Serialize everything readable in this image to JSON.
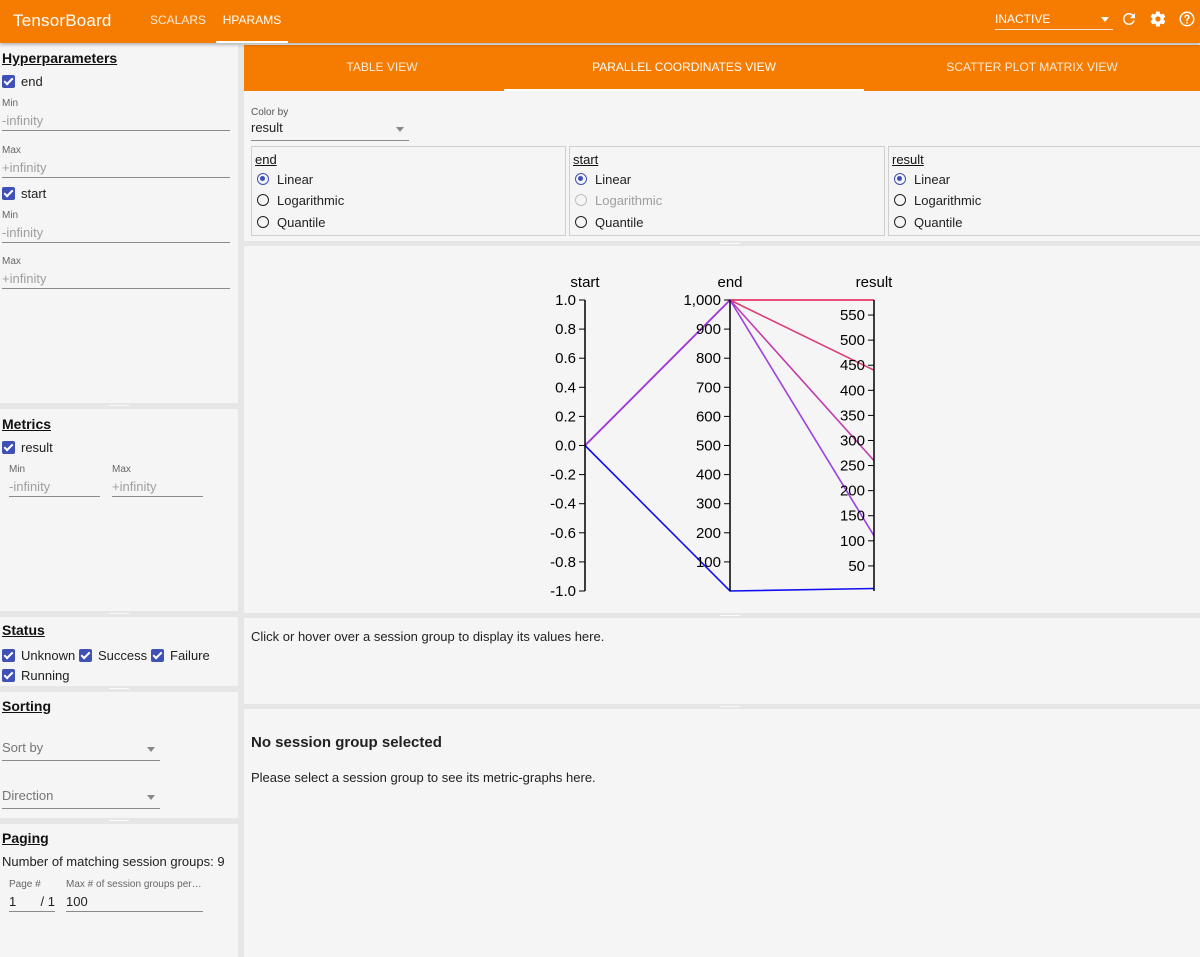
{
  "app": {
    "title": "TensorBoard",
    "tabs": [
      {
        "label": "SCALARS",
        "active": false
      },
      {
        "label": "HPARAMS",
        "active": true
      }
    ],
    "run_status": "INACTIVE",
    "icons": [
      "refresh-icon",
      "settings-icon",
      "help-icon"
    ],
    "accent_color": "#f57c00"
  },
  "sidebar": {
    "hyperparameters": {
      "title": "Hyperparameters",
      "items": [
        {
          "name": "end",
          "checked": true,
          "min_label": "Min",
          "min_placeholder": "-infinity",
          "max_label": "Max",
          "max_placeholder": "+infinity"
        },
        {
          "name": "start",
          "checked": true,
          "min_label": "Min",
          "min_placeholder": "-infinity",
          "max_label": "Max",
          "max_placeholder": "+infinity"
        }
      ]
    },
    "metrics": {
      "title": "Metrics",
      "items": [
        {
          "name": "result",
          "checked": true,
          "min_label": "Min",
          "min_placeholder": "-infinity",
          "max_label": "Max",
          "max_placeholder": "+infinity"
        }
      ]
    },
    "status": {
      "title": "Status",
      "options": [
        {
          "label": "Unknown",
          "checked": true
        },
        {
          "label": "Success",
          "checked": true
        },
        {
          "label": "Failure",
          "checked": true
        },
        {
          "label": "Running",
          "checked": true
        }
      ]
    },
    "sorting": {
      "title": "Sorting",
      "sort_by_placeholder": "Sort by",
      "direction_placeholder": "Direction"
    },
    "paging": {
      "title": "Paging",
      "matching_text": "Number of matching session groups: 9",
      "page_label": "Page #",
      "page_value": "1",
      "page_total": "/ 1",
      "max_label": "Max # of session groups per…",
      "max_value": "100"
    }
  },
  "main": {
    "view_tabs": [
      {
        "label": "TABLE VIEW",
        "active": false
      },
      {
        "label": "PARALLEL COORDINATES VIEW",
        "active": true
      },
      {
        "label": "SCATTER PLOT MATRIX VIEW",
        "active": false
      }
    ],
    "color_by_label": "Color by",
    "color_by_value": "result",
    "scale_boxes": [
      {
        "name": "end",
        "options": [
          {
            "label": "Linear",
            "selected": true,
            "disabled": false
          },
          {
            "label": "Logarithmic",
            "selected": false,
            "disabled": false
          },
          {
            "label": "Quantile",
            "selected": false,
            "disabled": false
          }
        ]
      },
      {
        "name": "start",
        "options": [
          {
            "label": "Linear",
            "selected": true,
            "disabled": false
          },
          {
            "label": "Logarithmic",
            "selected": false,
            "disabled": true
          },
          {
            "label": "Quantile",
            "selected": false,
            "disabled": false
          }
        ]
      },
      {
        "name": "result",
        "options": [
          {
            "label": "Linear",
            "selected": true,
            "disabled": false
          },
          {
            "label": "Logarithmic",
            "selected": false,
            "disabled": false
          },
          {
            "label": "Quantile",
            "selected": false,
            "disabled": false
          }
        ]
      }
    ],
    "hover_hint": "Click or hover over a session group to display its values here.",
    "no_selection_title": "No session group selected",
    "no_selection_text": "Please select a session group to see its metric-graphs here."
  },
  "chart_data": {
    "type": "parallel_coordinates",
    "axes": [
      {
        "name": "start",
        "ticks": [
          "1.0",
          "0.8",
          "0.6",
          "0.4",
          "0.2",
          "0.0",
          "-0.2",
          "-0.4",
          "-0.6",
          "-0.8",
          "-1.0"
        ],
        "range": [
          -1.0,
          1.0
        ]
      },
      {
        "name": "end",
        "ticks": [
          "1,000",
          "900",
          "800",
          "700",
          "600",
          "500",
          "400",
          "300",
          "200",
          "100"
        ],
        "range": [
          0,
          1000
        ]
      },
      {
        "name": "result",
        "ticks": [
          "550",
          "500",
          "450",
          "400",
          "350",
          "300",
          "250",
          "200",
          "150",
          "100",
          "50"
        ],
        "range": [
          0,
          580
        ]
      }
    ],
    "series": [
      {
        "values": [
          0.0,
          1000,
          580
        ],
        "color": "#e8184f"
      },
      {
        "values": [
          0.0,
          1000,
          440
        ],
        "color": "#dc3a78"
      },
      {
        "values": [
          0.0,
          1000,
          260
        ],
        "color": "#c03ab0"
      },
      {
        "values": [
          0.0,
          1000,
          110
        ],
        "color": "#9c40e0"
      },
      {
        "values": [
          0.0,
          0,
          5
        ],
        "color": "#1010f0"
      }
    ]
  }
}
